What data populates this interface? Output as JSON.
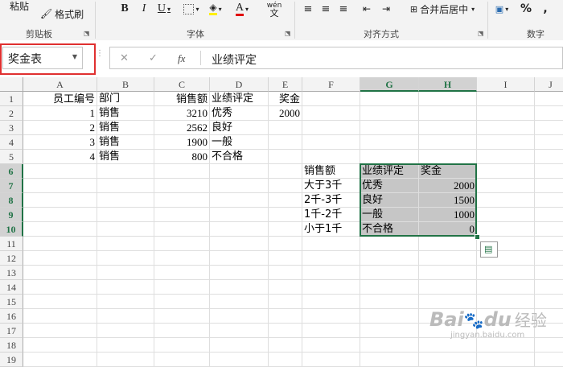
{
  "ribbon": {
    "paste_label": "粘贴",
    "format_painter_label": "格式刷",
    "clipboard_group": "剪贴板",
    "font_group": "字体",
    "align_group": "对齐方式",
    "number_group": "数字",
    "bold": "B",
    "italic": "I",
    "underline": "U",
    "merge_label": "合并后居中",
    "percent": "%",
    "comma": ",",
    "phonetic_top": "wén",
    "phonetic_bottom": "文"
  },
  "formula_bar": {
    "name_box": "奖金表",
    "fx": "fx",
    "content": "业绩评定"
  },
  "columns": [
    "A",
    "B",
    "C",
    "D",
    "E",
    "F",
    "G",
    "H",
    "I",
    "J"
  ],
  "rows": [
    "1",
    "2",
    "3",
    "4",
    "5",
    "6",
    "7",
    "8",
    "9",
    "10",
    "11",
    "12",
    "13",
    "14",
    "15",
    "16",
    "17",
    "18",
    "19"
  ],
  "cells": {
    "A1": "员工编号",
    "B1": "部门",
    "C1": "销售额",
    "D1": "业绩评定",
    "E1": "奖金",
    "A2": "1",
    "B2": "销售",
    "C2": "3210",
    "D2": "优秀",
    "E2": "2000",
    "A3": "2",
    "B3": "销售",
    "C3": "2562",
    "D3": "良好",
    "A4": "3",
    "B4": "销售",
    "C4": "1900",
    "D4": "一般",
    "A5": "4",
    "B5": "销售",
    "C5": "800",
    "D5": "不合格",
    "F6": "销售额",
    "G6": "业绩评定",
    "H6": "奖金",
    "F7": "大于3千",
    "G7": "优秀",
    "H7": "2000",
    "F8": "2千-3千",
    "G8": "良好",
    "H8": "1500",
    "F9": "1千-2千",
    "G9": "一般",
    "H9": "1000",
    "F10": "小于1千",
    "G10": "不合格",
    "H10": "0"
  },
  "watermark": {
    "brand": "Bai",
    "brand2": "du",
    "brand_cn": "经验",
    "url": "jingyan.baidu.com"
  }
}
